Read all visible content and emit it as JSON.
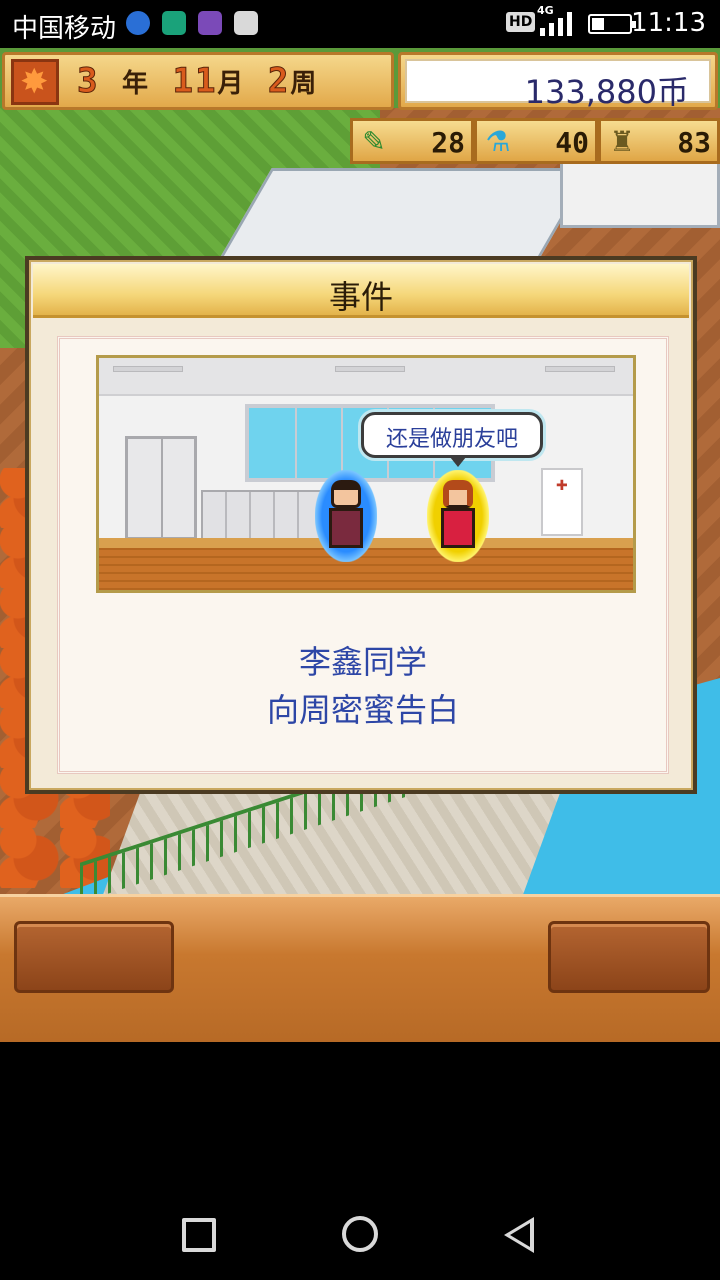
{
  "status_bar": {
    "carrier": "中国移动",
    "network_badge": "HD",
    "network_type": "4G",
    "time": "11:13",
    "icons": [
      "sogou-icon",
      "shield-icon",
      "gallery-icon",
      "calendar-icon",
      "signal-icon",
      "battery-icon"
    ]
  },
  "hud": {
    "year": "3",
    "year_unit": "年",
    "month": "11",
    "month_unit": "月",
    "week": "2",
    "week_unit": "周",
    "money": "133,880币",
    "stats": [
      {
        "icon": "pencil-icon",
        "value": "28"
      },
      {
        "icon": "flask-icon",
        "value": "40"
      },
      {
        "icon": "bell-icon",
        "value": "83"
      }
    ]
  },
  "event": {
    "title": "事件",
    "speech": "还是做朋友吧",
    "message_line1": "李鑫同学",
    "message_line2": "向周密蜜告白"
  },
  "navigation": {
    "buttons": [
      "back-button",
      "home-button",
      "recents-button"
    ]
  },
  "colors": {
    "hud_gold": "#e2a94a",
    "message_blue": "#2d46a6",
    "boy_aura": "#2a8cff",
    "girl_aura": "#f0d000"
  }
}
